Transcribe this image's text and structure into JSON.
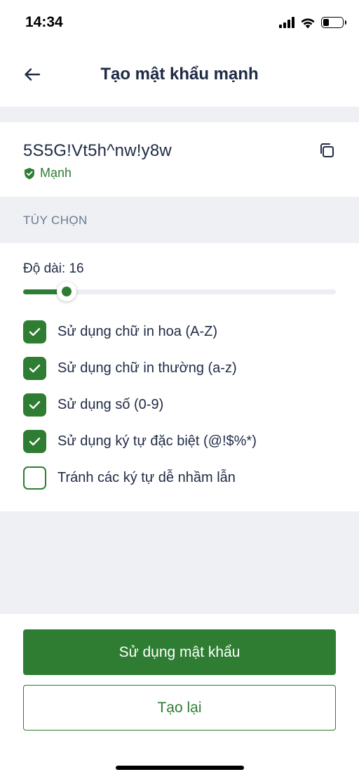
{
  "status_bar": {
    "time": "14:34",
    "icons": [
      "cellular-signal-icon",
      "wifi-icon",
      "battery-icon"
    ],
    "battery_level": 0.3
  },
  "header": {
    "title": "Tạo mật khẩu mạnh",
    "back_icon": "arrow-left-icon"
  },
  "password": {
    "value": "5S5G!Vt5h^nw!y8w",
    "copy_icon": "copy-icon",
    "strength_icon": "shield-check-icon",
    "strength_label": "Mạnh"
  },
  "options": {
    "section_label": "TÙY CHỌN",
    "length_label": "Độ dài: 16",
    "length_slider_fraction": 0.14,
    "items": [
      {
        "label": "Sử dụng chữ in hoa (A-Z)",
        "checked": true
      },
      {
        "label": "Sử dụng chữ in thường (a-z)",
        "checked": true
      },
      {
        "label": "Sử dụng số (0-9)",
        "checked": true
      },
      {
        "label": "Sử dụng ký tự đặc biệt (@!$%*)",
        "checked": true
      },
      {
        "label": "Tránh các ký tự dễ nhầm lẫn",
        "checked": false
      }
    ]
  },
  "actions": {
    "primary_label": "Sử dụng mật khẩu",
    "secondary_label": "Tạo lại"
  },
  "colors": {
    "accent": "#2e7d32",
    "text": "#1f2a44",
    "muted": "#6b7890",
    "background_gray": "#eef0f4"
  }
}
